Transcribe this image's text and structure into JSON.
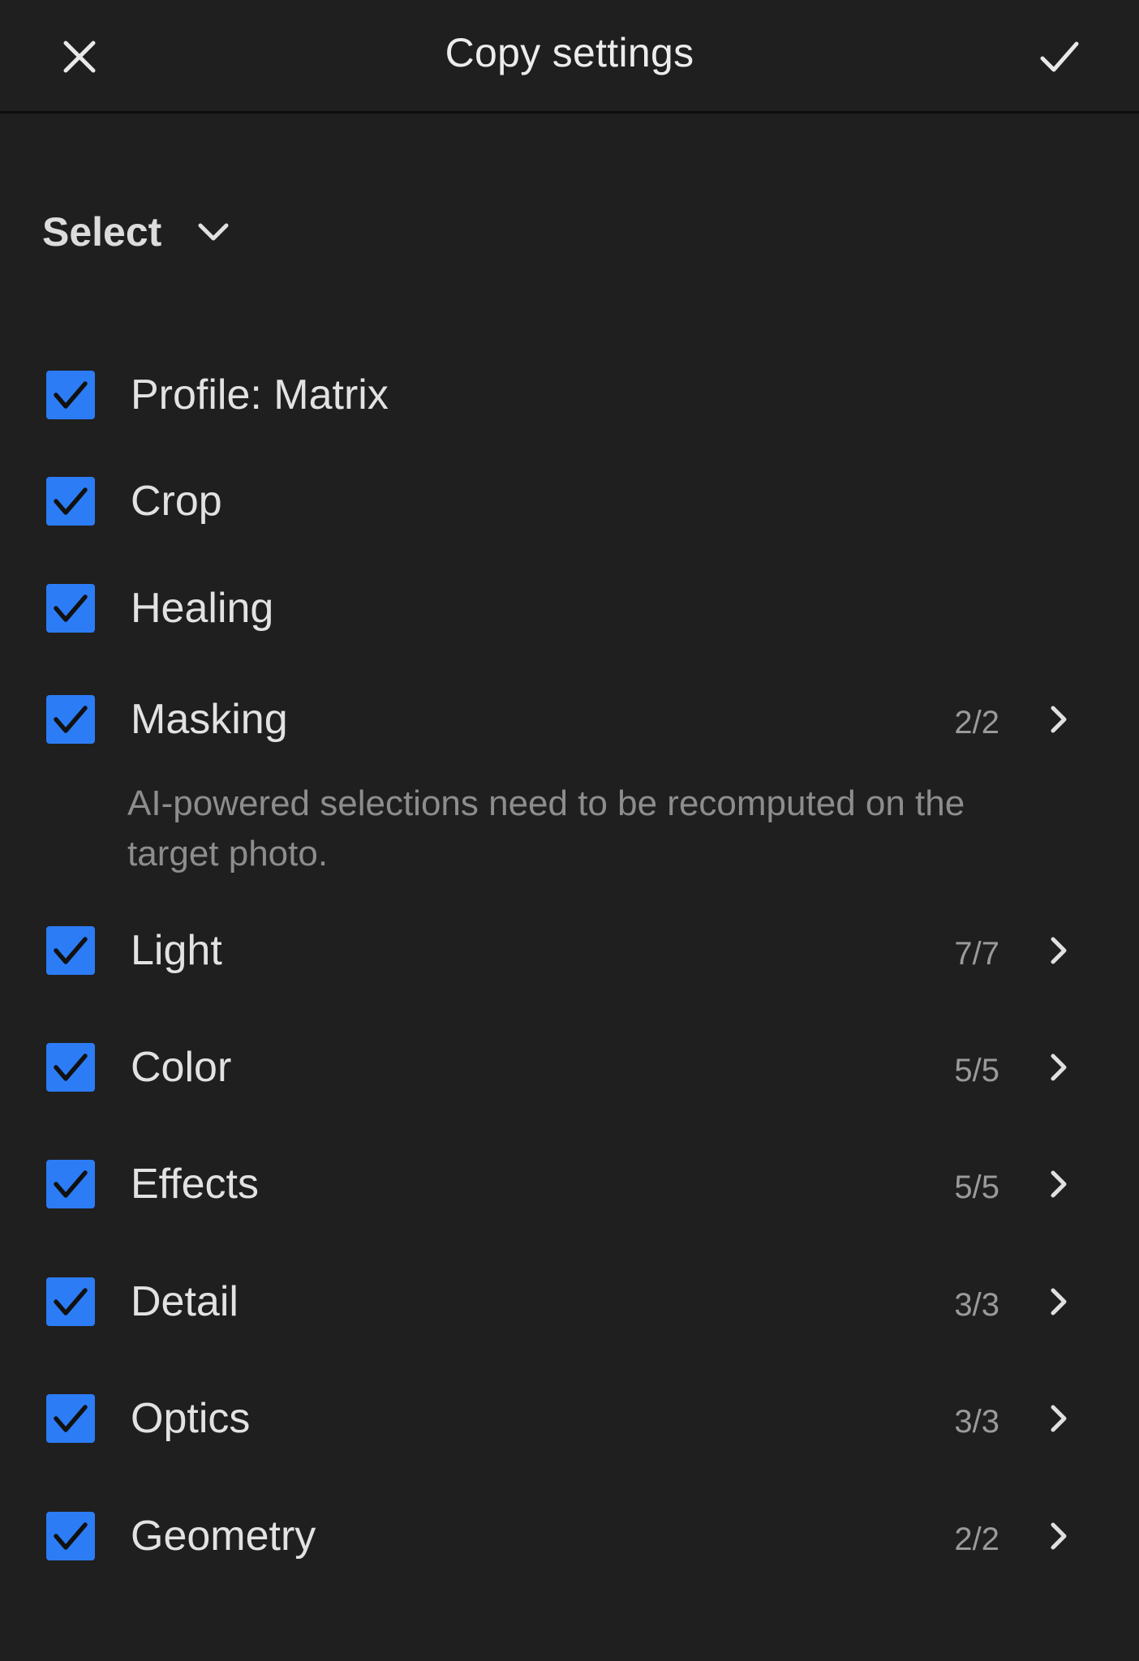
{
  "header": {
    "title": "Copy settings",
    "close_icon": "close-icon",
    "confirm_icon": "checkmark-icon"
  },
  "select": {
    "label": "Select",
    "icon": "chevron-down-icon"
  },
  "accent_color": "#2c7cf5",
  "items": [
    {
      "label": "Profile: Matrix",
      "count": "",
      "checked": true,
      "has_arrow": false
    },
    {
      "label": "Crop",
      "count": "",
      "checked": true,
      "has_arrow": false
    },
    {
      "label": "Healing",
      "count": "",
      "checked": true,
      "has_arrow": false
    },
    {
      "label": "Masking",
      "count": "2/2",
      "checked": true,
      "has_arrow": true
    },
    {
      "label": "Light",
      "count": "7/7",
      "checked": true,
      "has_arrow": true
    },
    {
      "label": "Color",
      "count": "5/5",
      "checked": true,
      "has_arrow": true
    },
    {
      "label": "Effects",
      "count": "5/5",
      "checked": true,
      "has_arrow": true
    },
    {
      "label": "Detail",
      "count": "3/3",
      "checked": true,
      "has_arrow": true
    },
    {
      "label": "Optics",
      "count": "3/3",
      "checked": true,
      "has_arrow": true
    },
    {
      "label": "Geometry",
      "count": "2/2",
      "checked": true,
      "has_arrow": true
    }
  ],
  "masking_note": "AI-powered selections need to be recomputed on the target photo."
}
